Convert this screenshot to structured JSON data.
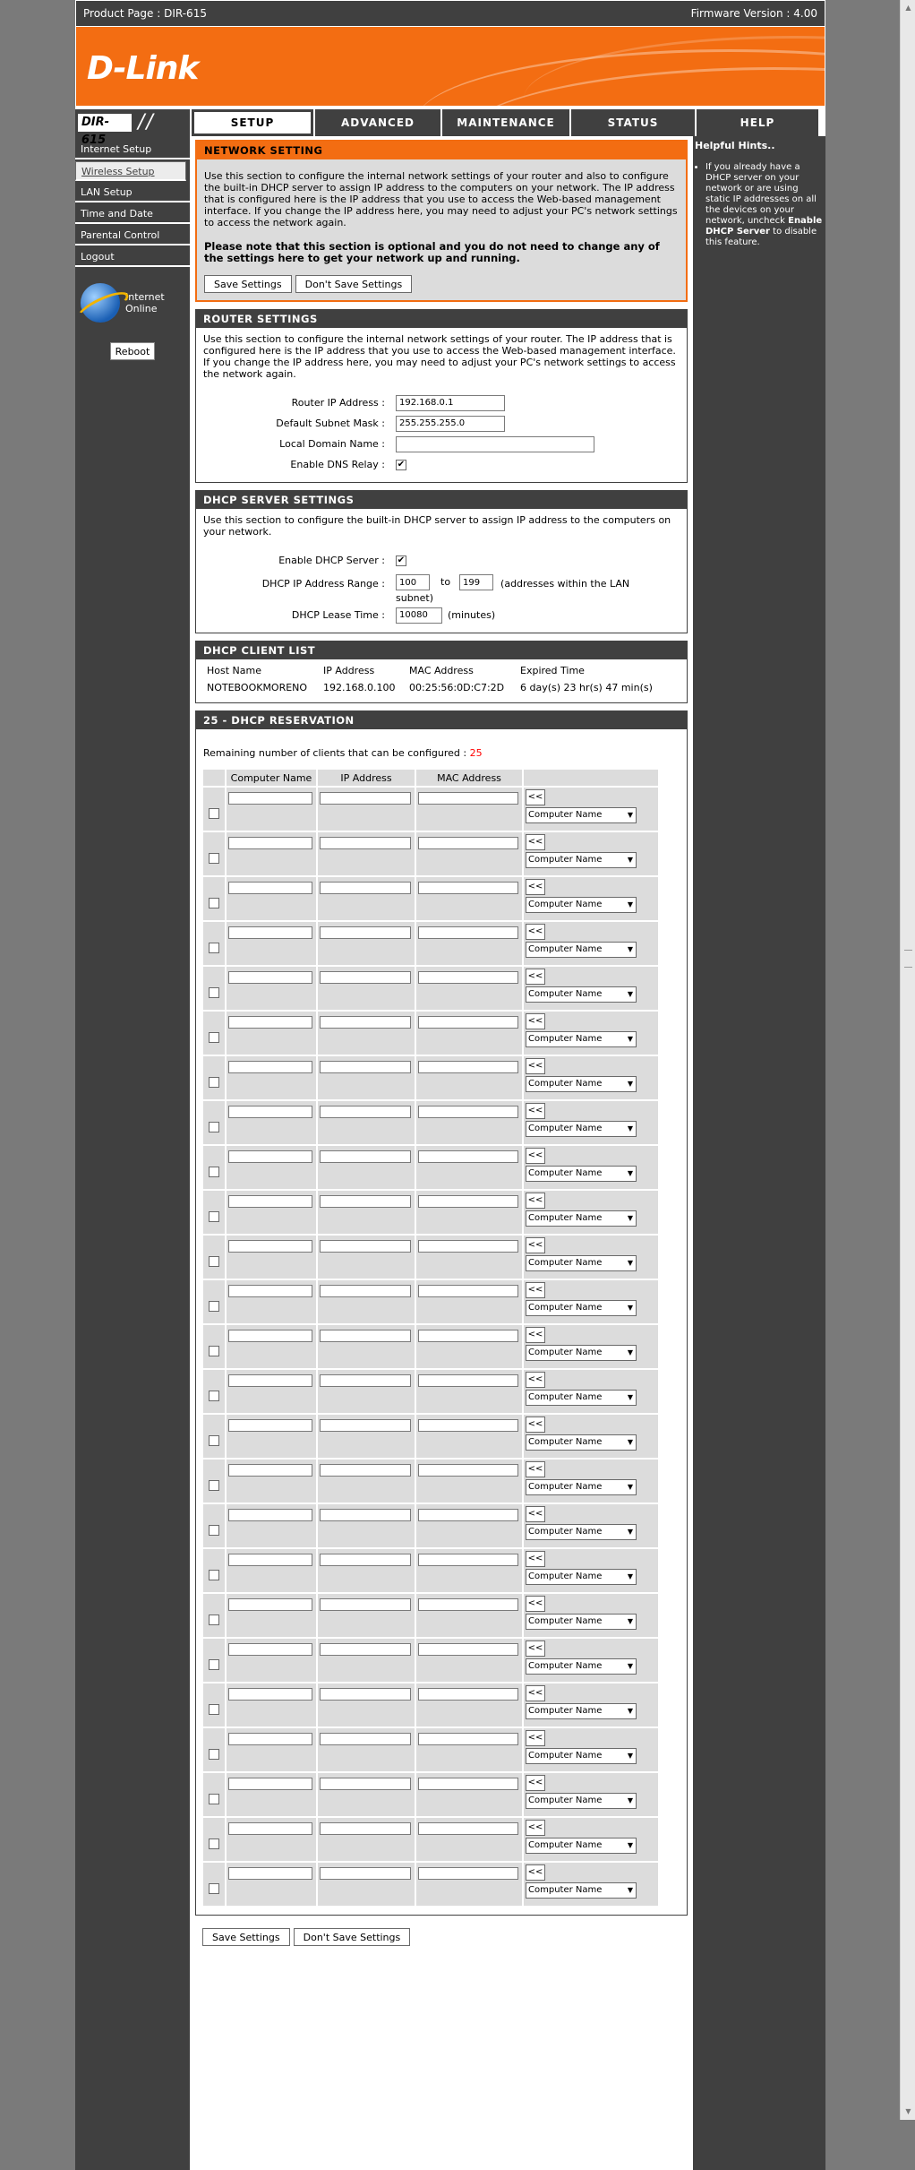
{
  "topbar": {
    "product_label": "Product Page :  DIR-615",
    "firmware_label": "Firmware Version : 4.00"
  },
  "brand": {
    "logo_text": "D-Link",
    "model": "DIR-615"
  },
  "tabs": [
    {
      "label": "SETUP",
      "active": true
    },
    {
      "label": "ADVANCED",
      "active": false
    },
    {
      "label": "MAINTENANCE",
      "active": false
    },
    {
      "label": "STATUS",
      "active": false
    },
    {
      "label": "HELP",
      "active": false
    }
  ],
  "sidebar": {
    "items": [
      {
        "label": "Internet Setup",
        "selected": false
      },
      {
        "label": "Wireless Setup",
        "selected": true
      },
      {
        "label": "LAN Setup",
        "selected": false
      },
      {
        "label": "Time and Date",
        "selected": false
      },
      {
        "label": "Parental Control",
        "selected": false
      },
      {
        "label": "Logout",
        "selected": false
      }
    ],
    "status_line1": "Internet",
    "status_line2": "Online",
    "reboot_label": "Reboot"
  },
  "network_setting": {
    "title": "NETWORK SETTING",
    "desc": "Use this section to configure the internal network settings of your router and also to configure the built-in DHCP server to assign IP address to the computers on your network. The IP address that is configured here is the IP address that you use to access the Web-based management interface. If you change the IP address here, you may need to adjust your PC's network settings to access the network again.",
    "note": "Please note that this section is optional and you do not need to change any of the settings here to get your network up and running.",
    "save_label": "Save Settings",
    "dont_save_label": "Don't Save Settings"
  },
  "router_settings": {
    "title": "ROUTER SETTINGS",
    "desc": "Use this section to configure the internal network settings of your router. The IP address that is configured here is the IP address that you use to access the Web-based management interface. If you change the IP address here, you may need to adjust your PC's network settings to access the network again.",
    "ip_label": "Router IP Address :",
    "ip_value": "192.168.0.1",
    "mask_label": "Default Subnet Mask :",
    "mask_value": "255.255.255.0",
    "domain_label": "Local Domain Name :",
    "domain_value": "",
    "dns_label": "Enable DNS Relay :",
    "dns_checked": "✔"
  },
  "dhcp_server": {
    "title": "DHCP SERVER SETTINGS",
    "desc": "Use this section to configure the built-in DHCP server to assign IP address to the computers on your network.",
    "enable_label": "Enable DHCP Server :",
    "enable_checked": "✔",
    "range_label": "DHCP IP Address Range :",
    "range_start": "100",
    "range_to": "to",
    "range_end": "199",
    "range_note": "(addresses within the LAN",
    "range_note2": "subnet)",
    "lease_label": "DHCP Lease Time :",
    "lease_value": "10080",
    "lease_unit": "(minutes)"
  },
  "dhcp_clients": {
    "title": "DHCP CLIENT LIST",
    "headers": [
      "Host Name",
      "IP Address",
      "MAC Address",
      "Expired Time"
    ],
    "rows": [
      [
        "NOTEBOOKMORENO",
        "192.168.0.100",
        "00:25:56:0D:C7:2D",
        "6 day(s) 23 hr(s) 47 min(s)"
      ]
    ]
  },
  "reservation": {
    "title": "25 - DHCP RESERVATION",
    "remaining_label": "Remaining number of clients that can be configured : ",
    "remaining_value": "25",
    "headers": [
      "",
      "Computer Name",
      "IP Address",
      "MAC Address",
      ""
    ],
    "copy_label": "<<",
    "select_value": "Computer Name",
    "row_count": 25,
    "save_label": "Save Settings",
    "dont_save_label": "Don't Save Settings"
  },
  "hints": {
    "title": "Helpful Hints..",
    "text_pre": "If you already have a DHCP server on your network or are using static IP addresses on all the devices on your network, uncheck ",
    "text_bold": "Enable DHCP Server",
    "text_post": " to disable this feature."
  }
}
